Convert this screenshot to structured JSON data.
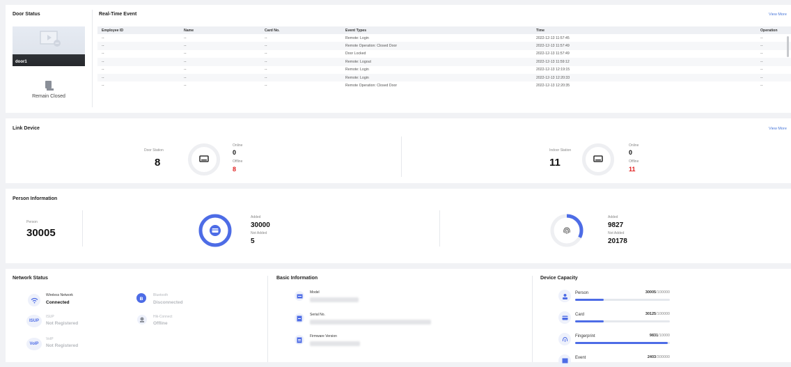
{
  "door_status": {
    "title": "Door Status",
    "door_name": "door1",
    "state": "Remain Closed"
  },
  "realtime": {
    "title": "Real-Time Event",
    "view_more": "View More",
    "columns": [
      "Employee ID",
      "Name",
      "Card No.",
      "Event Types",
      "Time",
      "Operation"
    ],
    "rows": [
      [
        "--",
        "--",
        "--",
        "Remote: Login",
        "2022-12-13 11:57:45",
        "--"
      ],
      [
        "--",
        "--",
        "--",
        "Remote Operation: Closed Door",
        "2022-12-13 11:57:49",
        "--"
      ],
      [
        "--",
        "--",
        "--",
        "Door Locked",
        "2022-12-13 11:57:49",
        "--"
      ],
      [
        "--",
        "--",
        "--",
        "Remote: Logout",
        "2022-12-13 11:59:12",
        "--"
      ],
      [
        "--",
        "--",
        "--",
        "Remote: Login",
        "2022-12-13 12:19:15",
        "--"
      ],
      [
        "--",
        "--",
        "--",
        "Remote: Login",
        "2022-12-13 12:20:33",
        "--"
      ],
      [
        "--",
        "--",
        "--",
        "Remote Operation: Closed Door",
        "2022-12-13 12:20:35",
        "--"
      ]
    ]
  },
  "link_device": {
    "title": "Link Device",
    "view_more": "View More",
    "door_station": {
      "label": "Door Station",
      "total": "8",
      "online_label": "Online",
      "online": "0",
      "offline_label": "Offline",
      "offline": "8"
    },
    "indoor_station": {
      "label": "Indoor Station",
      "total": "11",
      "online_label": "Online",
      "online": "0",
      "offline_label": "Offline",
      "offline": "11"
    }
  },
  "person_info": {
    "title": "Person Information",
    "person_label": "Person",
    "person_total": "30005",
    "card": {
      "added_label": "Added",
      "added": "30000",
      "not_added_label": "Not Added",
      "not_added": "5",
      "fraction": 0.9998
    },
    "fingerprint": {
      "added_label": "Added",
      "added": "9827",
      "not_added_label": "Not Added",
      "not_added": "20178",
      "fraction": 0.3275
    }
  },
  "network": {
    "title": "Network Status",
    "items": [
      {
        "name": "Wireless Network",
        "status": "Connected",
        "active": true
      },
      {
        "name": "Bluetooth",
        "status": "Disconnected",
        "active": false
      },
      {
        "name": "ISUP",
        "status": "Not Registered",
        "active": false
      },
      {
        "name": "Hik-Connect",
        "status": "Offline",
        "active": false
      },
      {
        "name": "VoIP",
        "status": "Not Registered",
        "active": false
      }
    ]
  },
  "basic_info": {
    "title": "Basic Information",
    "items": [
      {
        "label": "Model"
      },
      {
        "label": "Serial No."
      },
      {
        "label": "Firmware Version"
      }
    ]
  },
  "capacity": {
    "title": "Device Capacity",
    "items": [
      {
        "label": "Person",
        "used": "30005",
        "total": "/100000",
        "fraction": 0.3
      },
      {
        "label": "Card",
        "used": "30125",
        "total": "/100000",
        "fraction": 0.3
      },
      {
        "label": "Fingerprint",
        "used": "9831",
        "total": "/10000",
        "fraction": 0.98
      },
      {
        "label": "Event",
        "used": "2403",
        "total": "/300000",
        "fraction": 0.01
      }
    ]
  },
  "colors": {
    "accent": "#4d6ce6",
    "red": "#e02020",
    "link": "#4a78d9"
  }
}
